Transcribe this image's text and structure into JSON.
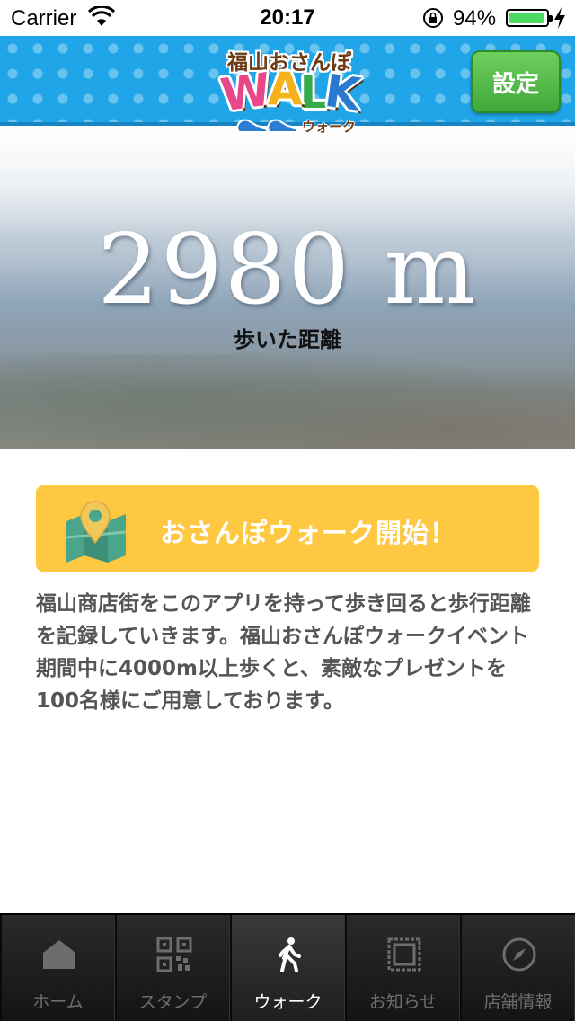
{
  "status_bar": {
    "carrier": "Carrier",
    "time": "20:17",
    "battery": "94%",
    "battery_level": 0.94
  },
  "header": {
    "logo_top": "福山おさんぽ",
    "logo_walk": [
      "W",
      "A",
      "L",
      "K"
    ],
    "logo_sub": "ウォーク",
    "settings_label": "設定"
  },
  "hero": {
    "distance": "2980 m",
    "distance_label": "歩いた距離"
  },
  "main": {
    "start_label": "おさんぽウォーク開始！",
    "description": "福山商店街をこのアプリを持って歩き回ると歩行距離を記録していきます。福山おさんぽウォークイベント期間中に4000m以上歩くと、素敵なプレゼントを100名様にご用意しております。"
  },
  "tabs": [
    {
      "label": "ホーム",
      "icon": "home-icon"
    },
    {
      "label": "スタンプ",
      "icon": "qr-code-icon"
    },
    {
      "label": "ウォーク",
      "icon": "walking-icon",
      "active": true
    },
    {
      "label": "お知らせ",
      "icon": "stamp-frame-icon"
    },
    {
      "label": "店舗情報",
      "icon": "compass-icon"
    }
  ],
  "colors": {
    "header_blue": "#20a6e8",
    "settings_green": "#4cb845",
    "start_yellow": "#ffc843",
    "battery_green": "#4cd964"
  }
}
